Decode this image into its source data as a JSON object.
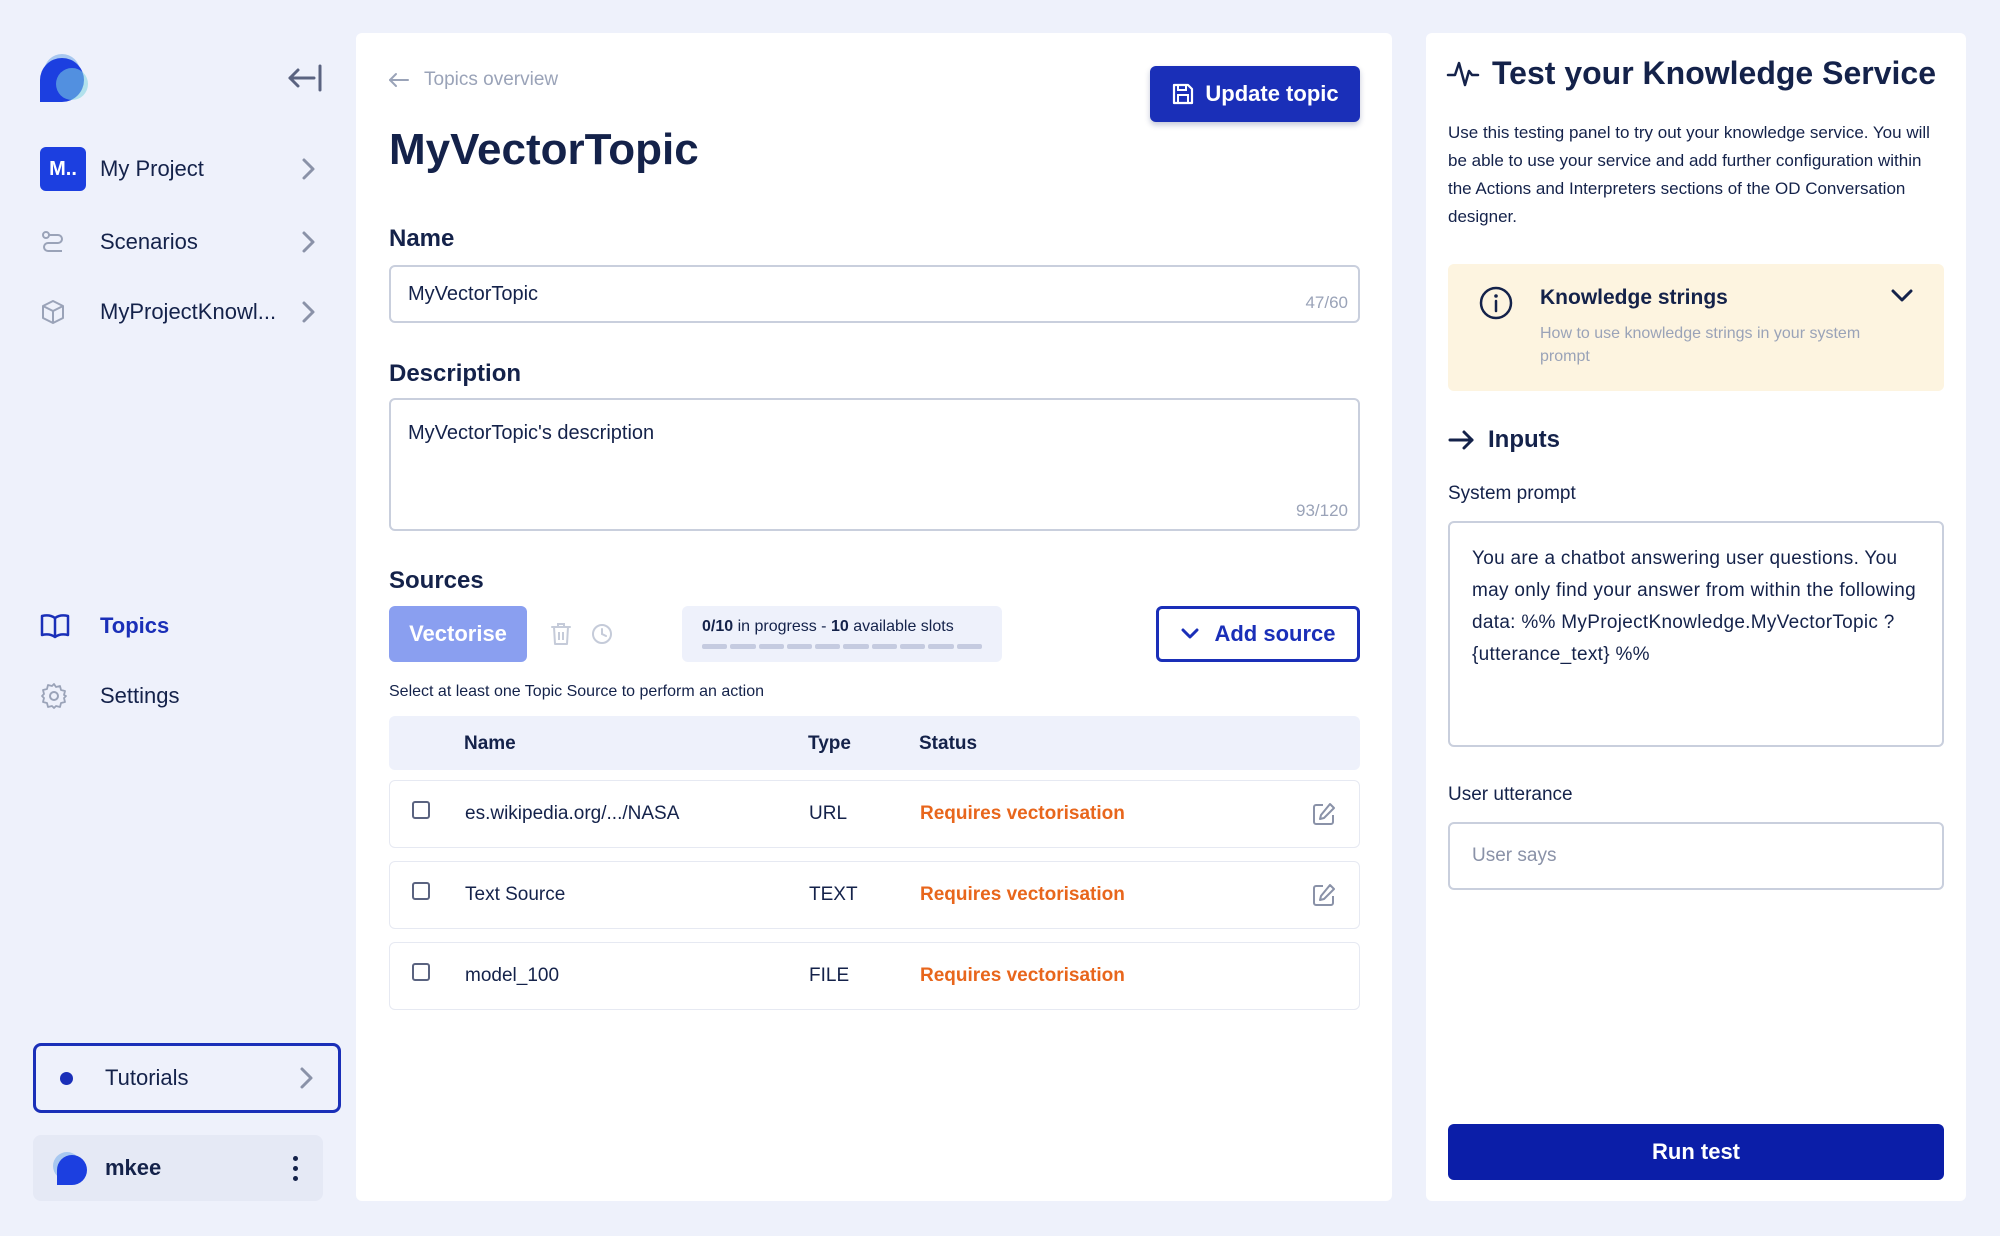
{
  "sidebar": {
    "project": {
      "badge": "M..",
      "label": "My Project"
    },
    "scenarios": {
      "label": "Scenarios"
    },
    "knowledge": {
      "label": "MyProjectKnowl..."
    },
    "topics": {
      "label": "Topics"
    },
    "settings": {
      "label": "Settings"
    },
    "tutorials": {
      "label": "Tutorials"
    },
    "user": {
      "name": "mkee"
    }
  },
  "main": {
    "back_label": "Topics overview",
    "update_label": "Update topic",
    "title": "MyVectorTopic",
    "name_label": "Name",
    "name_value": "MyVectorTopic",
    "name_count": "47/60",
    "description_label": "Description",
    "description_value": "MyVectorTopic's description",
    "description_count": "93/120",
    "sources_label": "Sources",
    "vectorise_label": "Vectorise",
    "progress": {
      "count": "0/10",
      "in_progress": " in progress - ",
      "slots": "10",
      "available": " available slots",
      "fraction": 0
    },
    "add_source_label": "Add source",
    "hint": "Select at least one Topic Source to perform an action",
    "table": {
      "headers": {
        "name": "Name",
        "type": "Type",
        "status": "Status"
      },
      "rows": [
        {
          "name": "es.wikipedia.org/.../NASA",
          "type": "URL",
          "status": "Requires vectorisation"
        },
        {
          "name": "Text Source",
          "type": "TEXT",
          "status": "Requires vectorisation"
        },
        {
          "name": "model_100",
          "type": "FILE",
          "status": "Requires vectorisation"
        }
      ]
    }
  },
  "right": {
    "title": "Test your Knowledge Service",
    "description": "Use this testing panel to try out your knowledge service. You will be able to use your service and add further configuration within the Actions and Interpreters sections of the OD Conversation designer.",
    "knowledge_card": {
      "title": "Knowledge strings",
      "subtitle": "How to use knowledge strings in your system prompt"
    },
    "inputs_label": "Inputs",
    "system_prompt_label": "System prompt",
    "system_prompt_value": "You are a chatbot answering user questions. You may only find your answer from within the following data: %% MyProjectKnowledge.MyVectorTopic ?{utterance_text} %%",
    "user_utterance_label": "User utterance",
    "user_utterance_placeholder": "User says",
    "run_label": "Run test"
  },
  "colors": {
    "primary": "#1a2fb8",
    "status_warning": "#e8661c",
    "background": "#eef1fb",
    "card_warm": "#fdf4e0"
  }
}
